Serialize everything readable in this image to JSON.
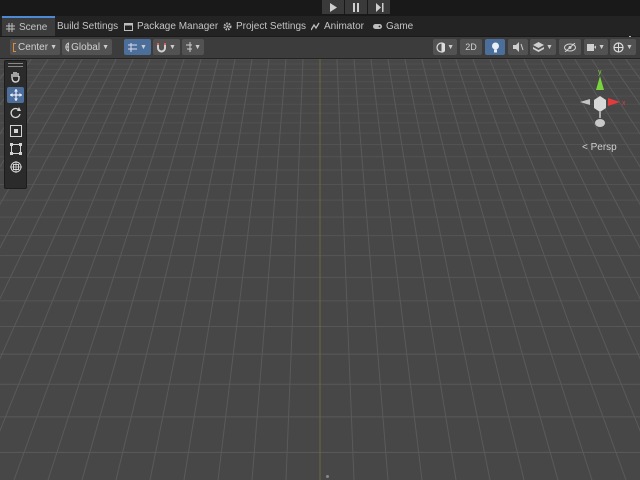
{
  "tabs": [
    {
      "label": "Scene",
      "icon": "hash-icon"
    },
    {
      "label": "Build Settings",
      "icon": ""
    },
    {
      "label": "Package Manager",
      "icon": "package-icon"
    },
    {
      "label": "Project Settings",
      "icon": "gear-icon"
    },
    {
      "label": "Animator",
      "icon": "animator-icon"
    },
    {
      "label": "Game",
      "icon": "gamepad-icon"
    }
  ],
  "toolbar": {
    "pivot_label": "Center",
    "space_label": "Global",
    "mode_2d": "2D"
  },
  "view": {
    "projection_label": "< Persp",
    "gizmo_x": "x",
    "gizmo_y": "y"
  },
  "colors": {
    "scene_bg": "#474747",
    "selected": "#4b6e9b",
    "gizmo_x": "#e33b3b",
    "gizmo_y": "#7ad23d"
  }
}
